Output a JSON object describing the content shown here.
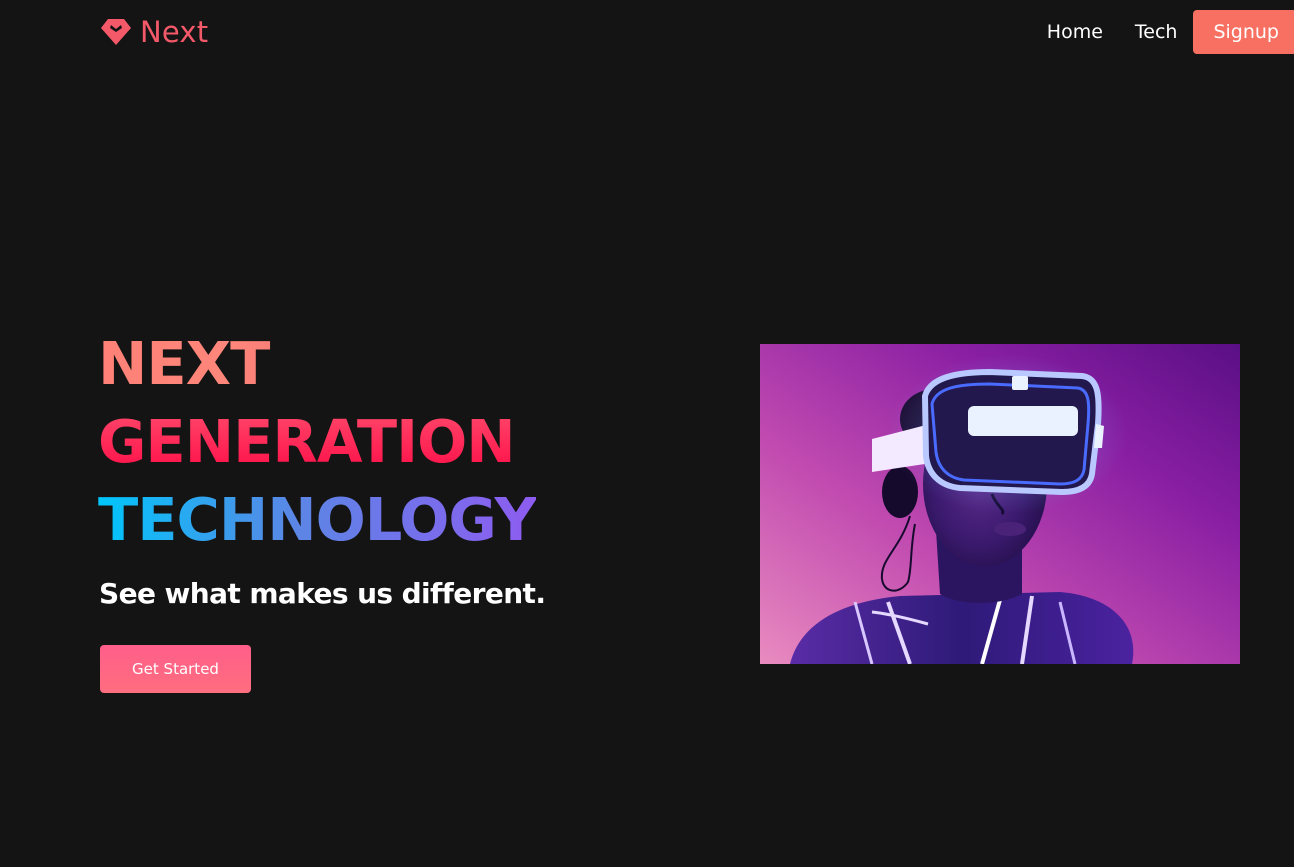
{
  "brand": {
    "name": "Next",
    "icon": "diamond-icon"
  },
  "nav": {
    "items": [
      {
        "label": "Home"
      },
      {
        "label": "Tech"
      }
    ],
    "signup_label": "Signup"
  },
  "hero": {
    "heading": {
      "line1": "NEXT",
      "line2": "GENERATION",
      "line3": "TECHNOLOGY"
    },
    "subheading": "See what makes us different.",
    "cta_label": "Get Started"
  },
  "colors": {
    "background": "#141414",
    "brand": "#f4596a",
    "signup_button": "#f77062",
    "cta_button": "#ff6e7f"
  },
  "image": {
    "subject": "person-wearing-vr-headset-neon"
  }
}
